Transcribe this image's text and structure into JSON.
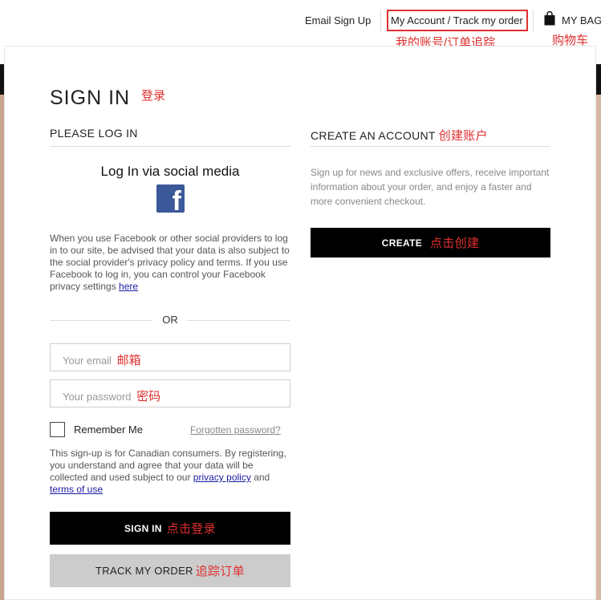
{
  "topbar": {
    "email_signup": "Email Sign Up",
    "account_link": "My Account / Track my order",
    "account_annotation": "我的账号/订单追踪",
    "bag_label": "MY BAG",
    "bag_annotation": "购物车"
  },
  "signin": {
    "heading": "SIGN IN",
    "heading_annotation": "登录",
    "login_section_title": "PLEASE LOG IN",
    "social_title": "Log In via social media",
    "social_note": "When you use Facebook or other social providers to log in to our site, be advised that your data is also subject to the social provider's privacy policy and terms.  If you use Facebook to log in, you can control your Facebook privacy settings",
    "social_note_link": "here",
    "or_label": "OR",
    "email_placeholder": "Your email",
    "email_annotation": "邮箱",
    "password_placeholder": "Your password",
    "password_annotation": "密码",
    "remember_me": "Remember Me",
    "forgot_password": "Forgotten password?",
    "consent_text": "This sign-up is for Canadian consumers. By registering, you understand and agree that your data will be collected and used subject to our",
    "privacy_link": "privacy policy",
    "and_text": "and",
    "terms_link": "terms of use",
    "signin_button": "SIGN IN",
    "signin_annotation": "点击登录",
    "track_button": "TRACK MY ORDER",
    "track_annotation": "追踪订单"
  },
  "create": {
    "section_title": "CREATE AN ACCOUNT",
    "section_annotation": "创建账户",
    "description": "Sign up for news and exclusive offers, receive important information about your order, and enjoy a faster and more convenient checkout.",
    "button_label": "CREATE",
    "button_annotation": "点击创建"
  },
  "icons": {
    "facebook": "facebook-icon",
    "bag": "shopping-bag-icon"
  },
  "colors": {
    "annotation": "#e03030",
    "facebook": "#3b5998",
    "primary_button": "#000000",
    "secondary_button": "#cccccc",
    "link": "#1a1aa6"
  }
}
